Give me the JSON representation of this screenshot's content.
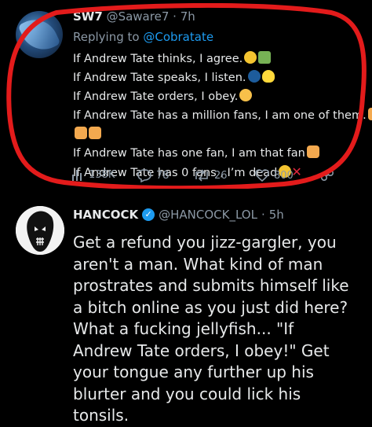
{
  "tweet1": {
    "author_name": "SW7",
    "author_handle": "@Saware7",
    "separator": "·",
    "time": "7h",
    "replying_prefix": "Replying to ",
    "replying_to": "@Cobratate",
    "lines": [
      "If Andrew Tate thinks, I agree.",
      "If Andrew Tate speaks, I listen.",
      "If Andrew Tate orders, I obey.",
      "If Andrew Tate has a million fans, I am one of them.",
      "",
      "If Andrew Tate has one fan, I am that fan",
      "If Andrew Tate has 0 fans , I’m dead"
    ],
    "emojis": {
      "line1": [
        "thinking-face-icon",
        "check-mark-icon"
      ],
      "line2": [
        "speaking-head-icon",
        "light-bulb-icon"
      ],
      "line3": [
        "saluting-face-icon"
      ],
      "line4": [
        "raising-hand-icon"
      ],
      "line5": [
        "raising-hand-icon",
        "raising-hand-icon"
      ],
      "line6": [
        "raising-hand-icon"
      ],
      "line7": [
        "astonished-face-icon",
        "cross-mark-icon"
      ]
    },
    "stats": {
      "views": "138K",
      "replies": "78",
      "retweets": "26",
      "likes": "800"
    },
    "highlight_color": "#e31b1b"
  },
  "tweet2": {
    "author_name": "HANCOCK",
    "verified": true,
    "author_handle": "@HANCOCK_LOL",
    "separator": "·",
    "time": "5h",
    "text": "Get a refund you jizz-gargler, you aren't a man. What kind of man prostrates and submits himself like a bitch online as you just did here? What a fucking jellyfish... \"If Andrew Tate orders, I obey!\" Get your tongue any further up his blurter and you could lick his tonsils."
  },
  "colors": {
    "background": "#000000",
    "text": "#e7e9ea",
    "muted": "#8b98a5",
    "link": "#1d9bf0"
  }
}
